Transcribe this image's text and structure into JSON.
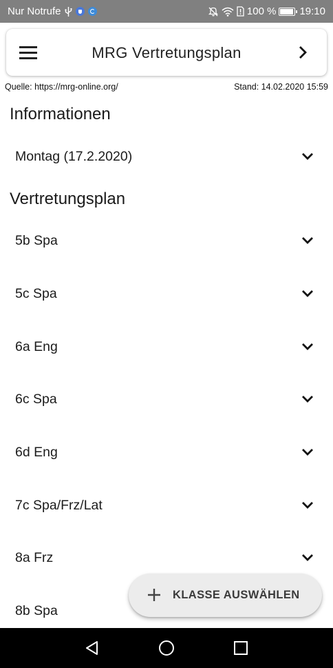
{
  "status_bar": {
    "carrier": "Nur Notrufe",
    "battery": "100 %",
    "time": "19:10"
  },
  "app_bar": {
    "title": "MRG Vertretungsplan"
  },
  "meta": {
    "source": "Quelle: https://mrg-online.org/",
    "updated": "Stand: 14.02.2020 15:59"
  },
  "informationen": {
    "heading": "Informationen",
    "items": [
      {
        "label": "Montag (17.2.2020)"
      }
    ]
  },
  "vertretungsplan": {
    "heading": "Vertretungsplan",
    "items": [
      {
        "label": "5b Spa"
      },
      {
        "label": "5c Spa"
      },
      {
        "label": "6a Eng"
      },
      {
        "label": "6c Spa"
      },
      {
        "label": "6d Eng"
      },
      {
        "label": "7c Spa/Frz/Lat"
      },
      {
        "label": "8a Frz"
      },
      {
        "label": "8b Spa"
      }
    ]
  },
  "fab": {
    "label": "KLASSE AUSWÄHLEN"
  },
  "icons": {
    "menu": "menu-icon",
    "next": "chevron-right-icon",
    "expand": "chevron-down-icon",
    "add": "plus-icon",
    "nav_back": "triangle-back-icon",
    "nav_home": "circle-home-icon",
    "nav_recents": "square-recents-icon"
  },
  "colors": {
    "status_bar": "#808080",
    "nav_bar": "#000000",
    "fab_background": "#ececec"
  }
}
